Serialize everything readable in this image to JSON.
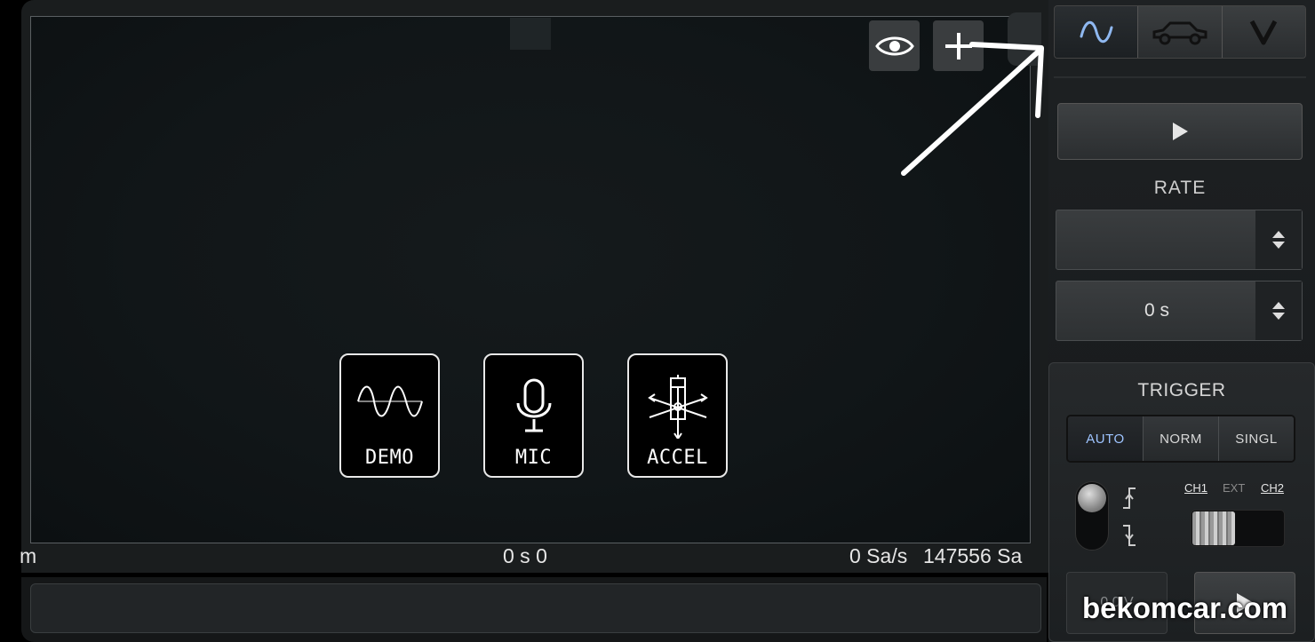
{
  "screen": {
    "status": {
      "left_fragment": "m",
      "center": "0 s 0",
      "sample_rate": "0 Sa/s",
      "sample_count": "147556 Sa"
    },
    "toolbar_icons": [
      "eye-icon",
      "plus-icon"
    ],
    "sources": [
      {
        "label": "DEMO",
        "icon": "sine-wave-icon"
      },
      {
        "label": "MIC",
        "icon": "microphone-icon"
      },
      {
        "label": "ACCEL",
        "icon": "accelerometer-icon"
      }
    ]
  },
  "side_panel": {
    "mode_tabs": [
      {
        "icon": "waveform-icon",
        "active": true
      },
      {
        "icon": "car-icon",
        "active": false
      },
      {
        "icon": "v-icon",
        "active": false
      }
    ],
    "run_icon": "play-icon",
    "rate_label": "RATE",
    "rate_value": "",
    "timebase_value": "0 s",
    "trigger": {
      "label": "TRIGGER",
      "modes": [
        {
          "label": "AUTO",
          "active": true
        },
        {
          "label": "NORM",
          "active": false
        },
        {
          "label": "SINGL",
          "active": false
        }
      ],
      "source_labels": {
        "ch1": "CH1",
        "ext": "EXT",
        "ch2": "CH2"
      },
      "level_value": "0.0 V"
    }
  },
  "watermark": "bekomcar.com",
  "colors": {
    "background": "#000000",
    "panel": "#1e2123",
    "screen": "#111618",
    "active_accent": "#9ec4ff",
    "annotation_arrow": "#ffffff"
  }
}
